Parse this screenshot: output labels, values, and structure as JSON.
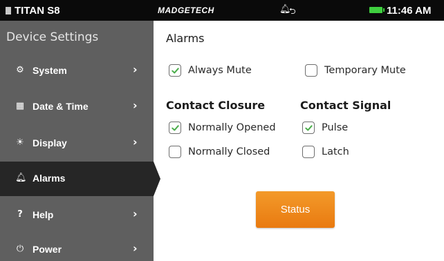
{
  "statusbar": {
    "device": "TITAN S8",
    "brand": "MADGETECH",
    "time": "11:46 AM",
    "icons": [
      "alarm-bell-icon",
      "usb-icon",
      "battery-icon"
    ]
  },
  "sidebar": {
    "title": "Device Settings",
    "items": [
      {
        "label": "System",
        "icon": "gear-icon"
      },
      {
        "label": "Date & Time",
        "icon": "calendar-icon"
      },
      {
        "label": "Display",
        "icon": "brightness-icon"
      },
      {
        "label": "Alarms",
        "icon": "alarm-bell-icon",
        "active": true
      },
      {
        "label": "Help",
        "icon": "help-icon"
      },
      {
        "label": "Power",
        "icon": "power-icon"
      }
    ]
  },
  "main": {
    "title": "Alarms",
    "always_mute": {
      "label": "Always Mute",
      "checked": true
    },
    "temporary_mute": {
      "label": "Temporary Mute",
      "checked": false
    },
    "contact_closure": {
      "heading": "Contact Closure",
      "normally_opened": {
        "label": "Normally Opened",
        "checked": true
      },
      "normally_closed": {
        "label": "Normally Closed",
        "checked": false
      }
    },
    "contact_signal": {
      "heading": "Contact Signal",
      "pulse": {
        "label": "Pulse",
        "checked": true
      },
      "latch": {
        "label": "Latch",
        "checked": false
      }
    },
    "status_button": "Status"
  },
  "colors": {
    "statusbar_bg": "#0a0a0a",
    "sidebar_bg": "#5f5f5f",
    "sidebar_active_bg": "#262626",
    "checkmark": "#4cae4c",
    "button_orange": "#ee8a1c",
    "battery": "#3fcf3f"
  }
}
